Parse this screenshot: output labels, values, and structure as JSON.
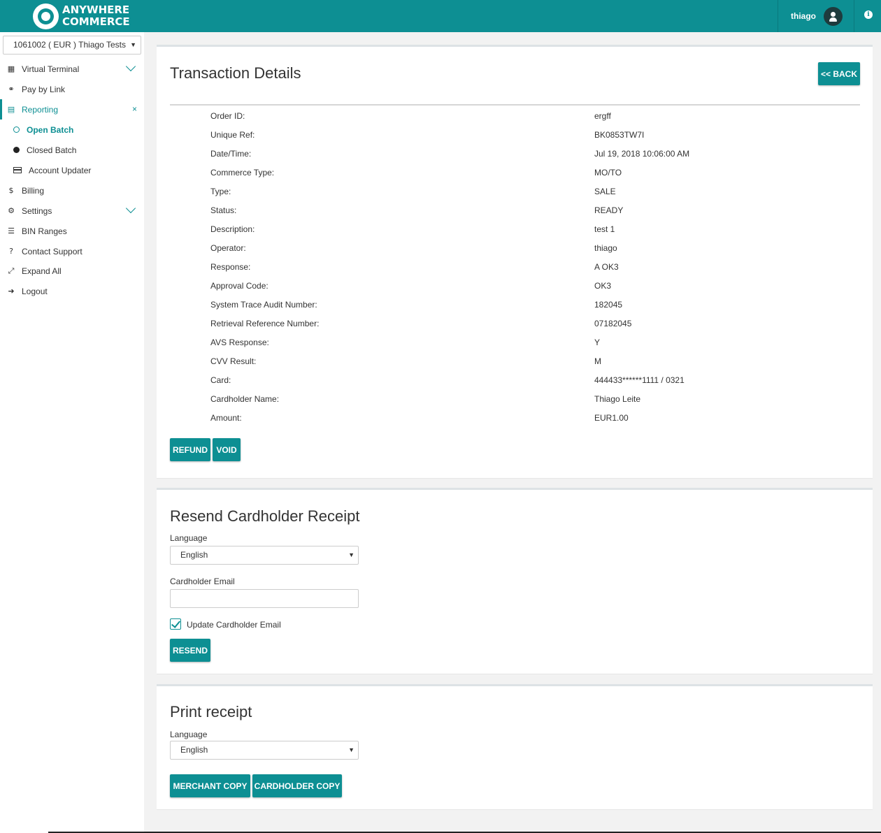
{
  "header": {
    "brand_line1": "ANYWHERE",
    "brand_line2": "COMMERCE",
    "username": "thiago"
  },
  "sidebar": {
    "account": "1061002 ( EUR ) Thiago Tests",
    "items": [
      {
        "label": "Virtual Terminal",
        "icon": "calculator-icon"
      },
      {
        "label": "Pay by Link",
        "icon": "link-icon"
      },
      {
        "label": "Reporting",
        "icon": "file-icon"
      },
      {
        "label": "Open Batch",
        "icon": "circle-outline-icon"
      },
      {
        "label": "Closed Batch",
        "icon": "circle-solid-icon"
      },
      {
        "label": "Account Updater",
        "icon": "credit-card-icon"
      },
      {
        "label": "Billing",
        "icon": "dollar-icon"
      },
      {
        "label": "Settings",
        "icon": "gears-icon"
      },
      {
        "label": "BIN Ranges",
        "icon": "list-icon"
      },
      {
        "label": "Contact Support",
        "icon": "question-icon"
      },
      {
        "label": "Expand All",
        "icon": "expand-icon"
      },
      {
        "label": "Logout",
        "icon": "sign-out-icon"
      }
    ],
    "close_glyph": "×"
  },
  "details": {
    "title": "Transaction Details",
    "back_label": "<< BACK",
    "rows": [
      {
        "label": "Order ID:",
        "value": "ergff"
      },
      {
        "label": "Unique Ref:",
        "value": "BK0853TW7I"
      },
      {
        "label": "Date/Time:",
        "value": "Jul 19, 2018 10:06:00 AM"
      },
      {
        "label": "Commerce Type:",
        "value": "MO/TO"
      },
      {
        "label": "Type:",
        "value": "SALE"
      },
      {
        "label": "Status:",
        "value": "READY"
      },
      {
        "label": "Description:",
        "value": "test 1"
      },
      {
        "label": "Operator:",
        "value": "thiago"
      },
      {
        "label": "Response:",
        "value": "A OK3"
      },
      {
        "label": "Approval Code:",
        "value": "OK3"
      },
      {
        "label": "System Trace Audit Number:",
        "value": "182045"
      },
      {
        "label": "Retrieval Reference Number:",
        "value": "07182045"
      },
      {
        "label": "AVS Response:",
        "value": "Y"
      },
      {
        "label": "CVV Result:",
        "value": "M"
      },
      {
        "label": "Card:",
        "value": "444433******1111 / 0321"
      },
      {
        "label": "Cardholder Name:",
        "value": "Thiago Leite"
      },
      {
        "label": "Amount:",
        "value": "EUR1.00"
      }
    ],
    "refund_label": "REFUND",
    "void_label": "VOID"
  },
  "resend": {
    "title": "Resend Cardholder Receipt",
    "language_label": "Language",
    "language_value": "English",
    "email_label": "Cardholder Email",
    "email_value": "",
    "update_label": "Update Cardholder Email",
    "update_checked": true,
    "resend_label": "RESEND"
  },
  "print": {
    "title": "Print receipt",
    "language_label": "Language",
    "language_value": "English",
    "merchant_label": "MERCHANT COPY",
    "cardholder_label": "CARDHOLDER COPY"
  },
  "colors": {
    "accent": "#0d8f93"
  }
}
